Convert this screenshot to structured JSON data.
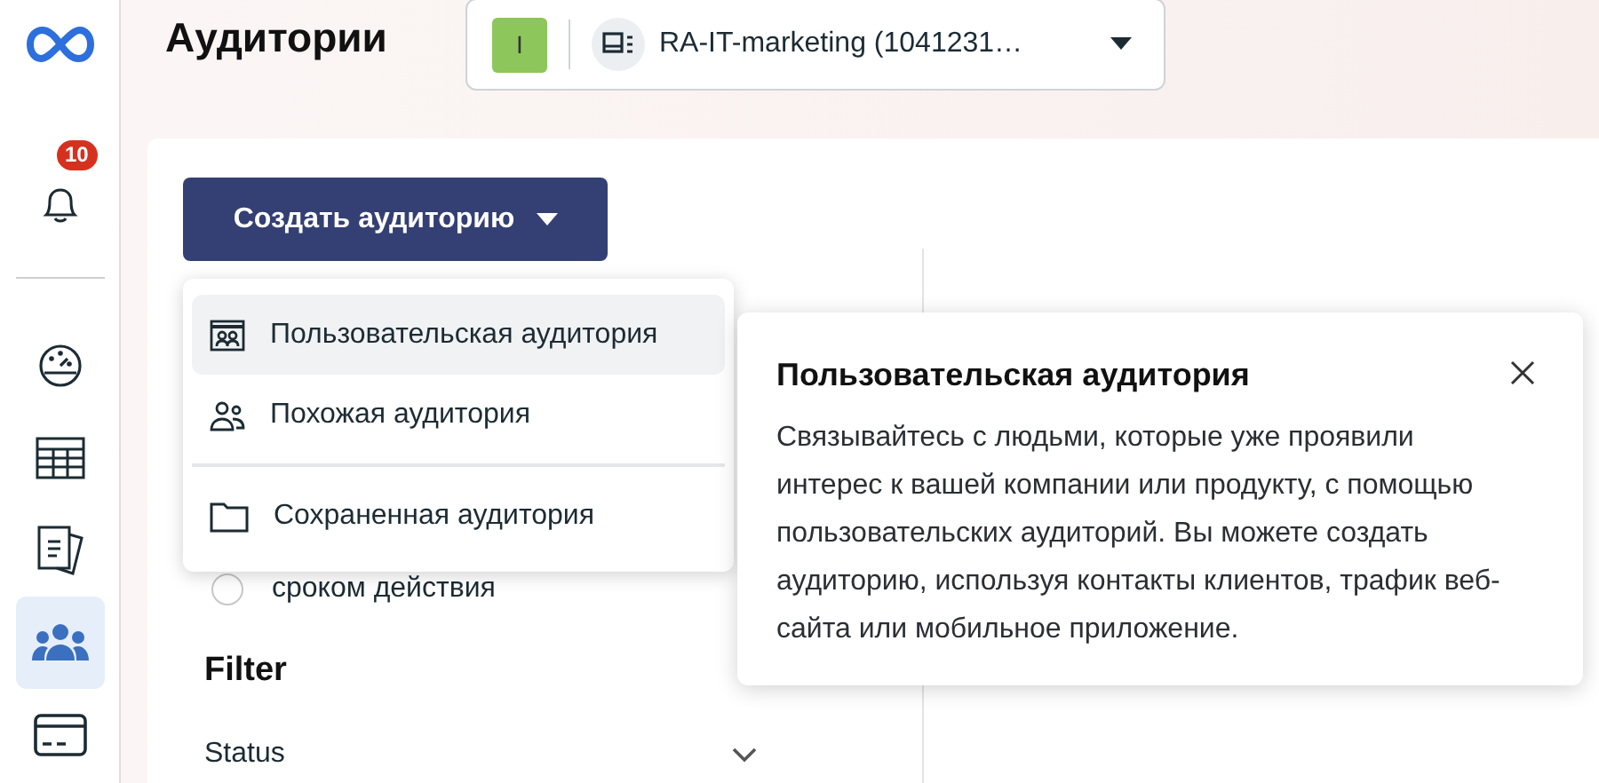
{
  "sidebar": {
    "notifications_badge": "10",
    "nav_items": [
      {
        "kind": "gauge",
        "selected": false
      },
      {
        "kind": "table",
        "selected": false
      },
      {
        "kind": "documents",
        "selected": false
      },
      {
        "kind": "people",
        "selected": true
      },
      {
        "kind": "card",
        "selected": false
      }
    ]
  },
  "page_title": "Аудитории",
  "account_selector": {
    "badge": "I",
    "label": "RA-IT-marketing (1041231…"
  },
  "create_button": {
    "label": "Создать аудиторию"
  },
  "create_menu": {
    "groups": [
      {
        "items": [
          {
            "kind": "custom",
            "label": "Пользовательская аудитория",
            "selected": true
          },
          {
            "kind": "lookalike",
            "label": "Похожая аудитория",
            "selected": false
          }
        ]
      },
      {
        "items": [
          {
            "kind": "saved",
            "label": "Сохраненная аудитория",
            "selected": false
          }
        ]
      }
    ]
  },
  "background_option": {
    "label": "сроком действия",
    "selected": false
  },
  "filter": {
    "title": "Filter",
    "sections": [
      {
        "label": "Status",
        "expanded": false
      }
    ]
  },
  "info_popover": {
    "title": "Пользовательская аудитория",
    "text": "Связывайтесь с людьми, которые уже проявили интерес к вашей компании или продукту, с помощью пользовательских аудиторий. Вы можете создать аудиторию, используя контакты клиентов, трафик веб-сайта или мобильное приложение."
  }
}
